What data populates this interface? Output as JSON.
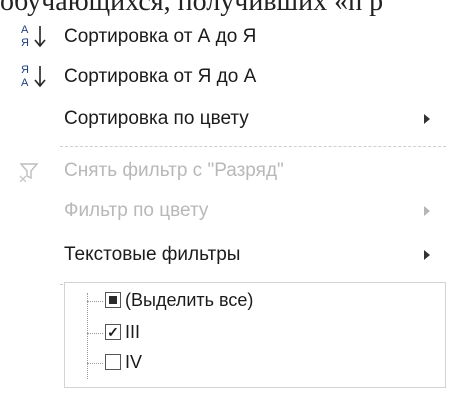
{
  "background_text": "обучающихся, получивших «n р",
  "menu": {
    "sort_az": "Сортировка от А до Я",
    "sort_za": "Сортировка от Я до А",
    "sort_by_color": "Сортировка по цвету",
    "clear_filter": "Снять фильтр с \"Разряд\"",
    "filter_by_color": "Фильтр по цвету",
    "text_filters": "Текстовые фильтры"
  },
  "tree": {
    "select_all": "(Выделить все)",
    "items": [
      {
        "label": "III",
        "checked": true
      },
      {
        "label": "IV",
        "checked": false
      }
    ]
  },
  "colors": {
    "disabled_text": "#b8b8b8",
    "border": "#d3d3d3"
  }
}
